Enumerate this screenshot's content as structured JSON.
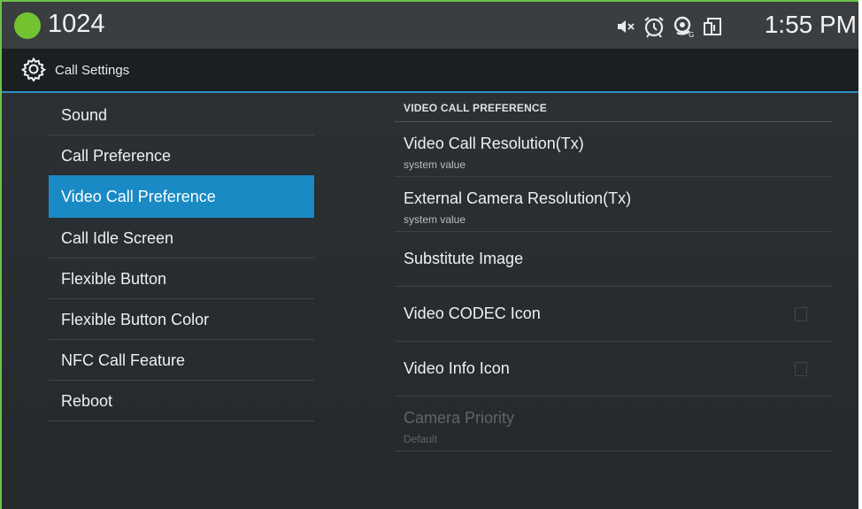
{
  "status_bar": {
    "extension": "1024",
    "time": "1:55 PM",
    "icons": [
      "speaker-mute-icon",
      "alarm-icon",
      "sync-icon",
      "sim-icon"
    ]
  },
  "action_bar": {
    "icon": "gear-icon",
    "title": "Call Settings"
  },
  "menu": {
    "items": [
      {
        "label": "Sound",
        "active": false
      },
      {
        "label": "Call Preference",
        "active": false
      },
      {
        "label": "Video Call Preference",
        "active": true
      },
      {
        "label": "Call Idle Screen",
        "active": false
      },
      {
        "label": "Flexible Button",
        "active": false
      },
      {
        "label": "Flexible Button Color",
        "active": false
      },
      {
        "label": "NFC Call Feature",
        "active": false
      },
      {
        "label": "Reboot",
        "active": false
      }
    ]
  },
  "pane": {
    "section_header": "VIDEO CALL PREFERENCE",
    "prefs": [
      {
        "title": "Video Call Resolution(Tx)",
        "summary": "system value"
      },
      {
        "title": "External Camera Resolution(Tx)",
        "summary": "system value"
      },
      {
        "title": "Substitute Image"
      },
      {
        "title": "Video CODEC Icon",
        "checked": false
      },
      {
        "title": "Video Info Icon",
        "checked": false
      },
      {
        "title": "Camera Priority",
        "summary": "Default",
        "enabled": false
      }
    ]
  },
  "colors": {
    "accent": "#1a8ac4",
    "status_green": "#73c230",
    "frame_border": "#6cc24a"
  }
}
